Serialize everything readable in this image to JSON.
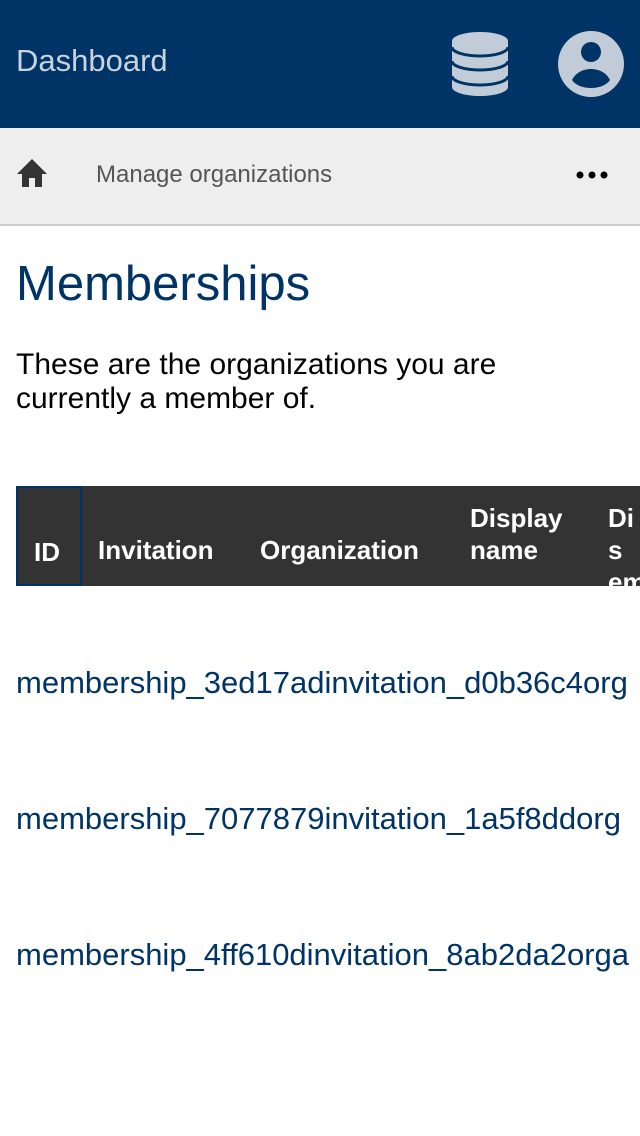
{
  "header": {
    "title": "Dashboard",
    "icons": [
      "database-icon",
      "user-account-icon"
    ]
  },
  "breadcrumb": {
    "home_icon": "home-icon",
    "current": "Manage organizations",
    "more_icon": "more-horizontal-icon"
  },
  "main": {
    "title": "Memberships",
    "description": "These are the organizations you are currently a member of.",
    "table": {
      "columns": [
        "ID",
        "Invitation",
        "Organization",
        "Display name",
        "Dis em"
      ],
      "rows": [
        {
          "id": "membership_3ed17ad",
          "invitation": "invitation_d0b36c4",
          "organization": "org"
        },
        {
          "id": "membership_7077879",
          "invitation": "invitation_1a5f8dd",
          "organization": "org"
        },
        {
          "id": "membership_4ff610d",
          "invitation": "invitation_8ab2da2",
          "organization": "orga"
        }
      ]
    }
  },
  "colors": {
    "primary": "#003366",
    "header_bg": "#333333",
    "breadcrumb_bg": "#eeeeee"
  }
}
